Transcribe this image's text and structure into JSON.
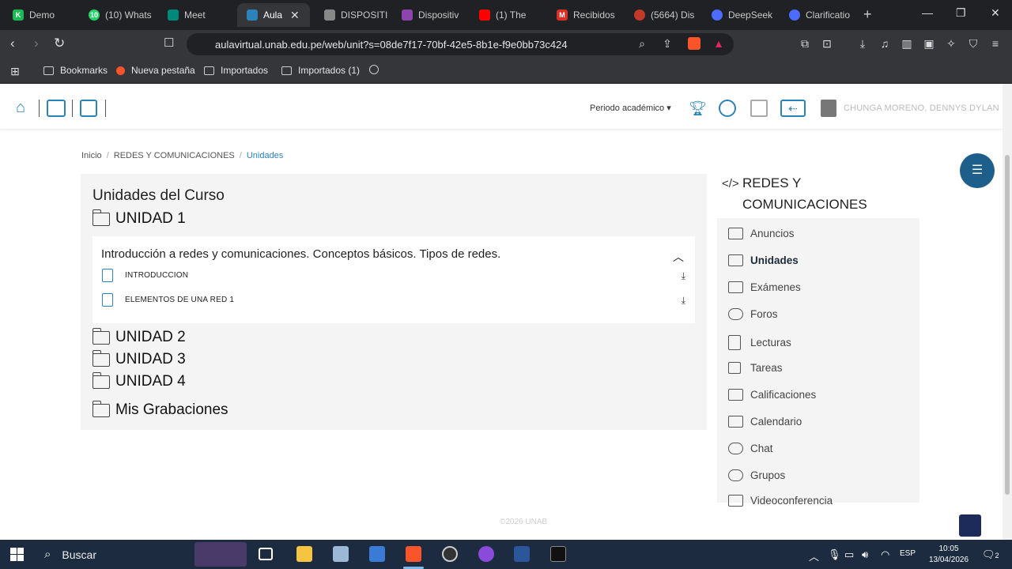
{
  "tabs": [
    {
      "label": "Demo",
      "icon_color": "#1db954",
      "icon_text": "K"
    },
    {
      "label": "(10) Whats",
      "icon_color": "#25d366",
      "icon_text": "10"
    },
    {
      "label": "Meet",
      "icon_color": "#00897b",
      "icon_text": ""
    },
    {
      "label": "Aula",
      "icon_color": "#2b83b7",
      "icon_text": ""
    },
    {
      "label": "DISPOSITI",
      "icon_color": "#888888",
      "icon_text": ""
    },
    {
      "label": "Dispositiv",
      "icon_color": "#8e44ad",
      "icon_text": ""
    },
    {
      "label": "(1) The",
      "icon_color": "#ff0000",
      "icon_text": ""
    },
    {
      "label": "Recibidos",
      "icon_color": "#d93025",
      "icon_text": "M"
    },
    {
      "label": "(5664) Dis",
      "icon_color": "#c0392b",
      "icon_text": ""
    },
    {
      "label": "DeepSeek",
      "icon_color": "#4d6bfe",
      "icon_text": ""
    },
    {
      "label": "Clarificatio",
      "icon_color": "#4d6bfe",
      "icon_text": ""
    }
  ],
  "address": {
    "url": "aulavirtual.unab.edu.pe/web/unit?s=08de7f17-70bf-42e5-8b1e-f9e0bb73c424"
  },
  "bookmarks": [
    "Bookmarks",
    "Nueva pestaña",
    "Importados",
    "Importados (1)"
  ],
  "header": {
    "periodo": "Periodo académico ▾",
    "user_name": "CHUNGA MORENO, DENNYS DYLAN"
  },
  "breadcrumb": {
    "home": "Inicio",
    "course": "REDES Y COMUNICACIONES",
    "current": "Unidades"
  },
  "main": {
    "title": "Unidades del Curso",
    "unit1": "UNIDAD 1",
    "unit1_desc": "Introducción a redes y comunicaciones. Conceptos básicos. Tipos de redes.",
    "files": [
      "INTRODUCCION",
      "ELEMENTOS DE UNA RED 1"
    ],
    "unit2": "UNIDAD 2",
    "unit3": "UNIDAD 3",
    "unit4": "UNIDAD 4",
    "recordings": "Mis Grabaciones"
  },
  "sidebar": {
    "title_line1": "REDES Y",
    "title_line2": "COMUNICACIONES",
    "items": [
      "Anuncios",
      "Unidades",
      "Exámenes",
      "Foros",
      "Lecturas",
      "Tareas",
      "Calificaciones",
      "Calendario",
      "Chat",
      "Grupos",
      "Videoconferencia"
    ],
    "active": "Unidades"
  },
  "footer": {
    "copyright": "©2026 UNAB"
  },
  "taskbar": {
    "search_placeholder": "Buscar",
    "lang": "ESP",
    "time": "10:05",
    "date": "13/04/2026",
    "notif_count": "2"
  },
  "colors": {
    "accent": "#2b83b7",
    "fab": "#1d5f8a"
  }
}
